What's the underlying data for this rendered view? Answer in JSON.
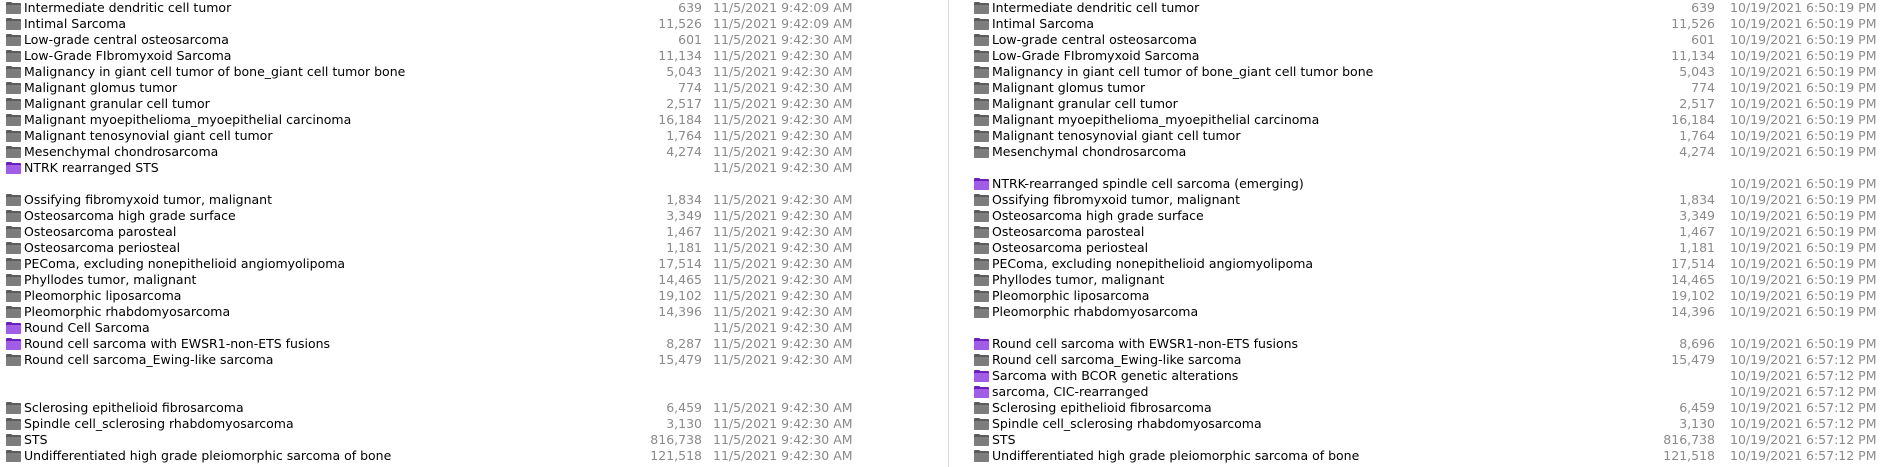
{
  "left_pane": {
    "rows": [
      {
        "name": "Intermediate dendritic cell tumor",
        "size": "639",
        "date": "11/5/2021 9:42:09 AM",
        "icon": "folder-gray-icon"
      },
      {
        "name": "Intimal Sarcoma",
        "size": "11,526",
        "date": "11/5/2021 9:42:09 AM",
        "icon": "folder-gray-icon"
      },
      {
        "name": "Low-grade central osteosarcoma",
        "size": "601",
        "date": "11/5/2021 9:42:30 AM",
        "icon": "folder-gray-icon"
      },
      {
        "name": "Low-Grade FIbromyxoid Sarcoma",
        "size": "11,134",
        "date": "11/5/2021 9:42:30 AM",
        "icon": "folder-gray-icon"
      },
      {
        "name": "Malignancy in giant cell tumor of bone_giant cell tumor bone",
        "size": "5,043",
        "date": "11/5/2021 9:42:30 AM",
        "icon": "folder-gray-icon"
      },
      {
        "name": "Malignant glomus tumor",
        "size": "774",
        "date": "11/5/2021 9:42:30 AM",
        "icon": "folder-gray-icon"
      },
      {
        "name": "Malignant granular cell tumor",
        "size": "2,517",
        "date": "11/5/2021 9:42:30 AM",
        "icon": "folder-gray-icon"
      },
      {
        "name": "Malignant myoepithelioma_myoepithelial carcinoma",
        "size": "16,184",
        "date": "11/5/2021 9:42:30 AM",
        "icon": "folder-gray-icon"
      },
      {
        "name": "Malignant tenosynovial giant cell tumor",
        "size": "1,764",
        "date": "11/5/2021 9:42:30 AM",
        "icon": "folder-gray-icon"
      },
      {
        "name": "Mesenchymal chondrosarcoma",
        "size": "4,274",
        "date": "11/5/2021 9:42:30 AM",
        "icon": "folder-gray-icon"
      },
      {
        "name": "NTRK rearranged STS",
        "size": "",
        "date": "11/5/2021 9:42:30 AM",
        "icon": "folder-purple-icon"
      },
      {
        "name": "",
        "size": "",
        "date": "",
        "icon": ""
      },
      {
        "name": "Ossifying fibromyxoid tumor, malignant",
        "size": "1,834",
        "date": "11/5/2021 9:42:30 AM",
        "icon": "folder-gray-icon"
      },
      {
        "name": "Osteosarcoma high grade surface",
        "size": "3,349",
        "date": "11/5/2021 9:42:30 AM",
        "icon": "folder-gray-icon"
      },
      {
        "name": "Osteosarcoma parosteal",
        "size": "1,467",
        "date": "11/5/2021 9:42:30 AM",
        "icon": "folder-gray-icon"
      },
      {
        "name": "Osteosarcoma periosteal",
        "size": "1,181",
        "date": "11/5/2021 9:42:30 AM",
        "icon": "folder-gray-icon"
      },
      {
        "name": "PEComa, excluding nonepithelioid angiomyolipoma",
        "size": "17,514",
        "date": "11/5/2021 9:42:30 AM",
        "icon": "folder-gray-icon"
      },
      {
        "name": "Phyllodes tumor, malignant",
        "size": "14,465",
        "date": "11/5/2021 9:42:30 AM",
        "icon": "folder-gray-icon"
      },
      {
        "name": "Pleomorphic liposarcoma",
        "size": "19,102",
        "date": "11/5/2021 9:42:30 AM",
        "icon": "folder-gray-icon"
      },
      {
        "name": "Pleomorphic rhabdomyosarcoma",
        "size": "14,396",
        "date": "11/5/2021 9:42:30 AM",
        "icon": "folder-gray-icon"
      },
      {
        "name": "Round Cell Sarcoma",
        "size": "",
        "date": "11/5/2021 9:42:30 AM",
        "icon": "folder-purple-icon"
      },
      {
        "name": "Round cell sarcoma with EWSR1-non-ETS fusions",
        "size": "8,287",
        "date": "11/5/2021 9:42:30 AM",
        "icon": "folder-purple-icon"
      },
      {
        "name": "Round cell sarcoma_Ewing-like sarcoma",
        "size": "15,479",
        "date": "11/5/2021 9:42:30 AM",
        "icon": "folder-gray-icon"
      },
      {
        "name": "",
        "size": "",
        "date": "",
        "icon": ""
      },
      {
        "name": "",
        "size": "",
        "date": "",
        "icon": ""
      },
      {
        "name": "Sclerosing epithelioid fibrosarcoma",
        "size": "6,459",
        "date": "11/5/2021 9:42:30 AM",
        "icon": "folder-gray-icon"
      },
      {
        "name": "Spindle cell_sclerosing rhabdomyosarcoma",
        "size": "3,130",
        "date": "11/5/2021 9:42:30 AM",
        "icon": "folder-gray-icon"
      },
      {
        "name": "STS",
        "size": "816,738",
        "date": "11/5/2021 9:42:30 AM",
        "icon": "folder-gray-icon"
      },
      {
        "name": "Undifferentiated high grade pleiomorphic sarcoma of bone",
        "size": "121,518",
        "date": "11/5/2021 9:42:30 AM",
        "icon": "folder-gray-icon"
      }
    ]
  },
  "right_pane": {
    "rows": [
      {
        "name": "Intermediate dendritic cell tumor",
        "size": "639",
        "date": "10/19/2021 6:50:19 PM",
        "icon": "folder-gray-icon"
      },
      {
        "name": "Intimal Sarcoma",
        "size": "11,526",
        "date": "10/19/2021 6:50:19 PM",
        "icon": "folder-gray-icon"
      },
      {
        "name": "Low-grade central osteosarcoma",
        "size": "601",
        "date": "10/19/2021 6:50:19 PM",
        "icon": "folder-gray-icon"
      },
      {
        "name": "Low-Grade FIbromyxoid Sarcoma",
        "size": "11,134",
        "date": "10/19/2021 6:50:19 PM",
        "icon": "folder-gray-icon"
      },
      {
        "name": "Malignancy in giant cell tumor of bone_giant cell tumor bone",
        "size": "5,043",
        "date": "10/19/2021 6:50:19 PM",
        "icon": "folder-gray-icon"
      },
      {
        "name": "Malignant glomus tumor",
        "size": "774",
        "date": "10/19/2021 6:50:19 PM",
        "icon": "folder-gray-icon"
      },
      {
        "name": "Malignant granular cell tumor",
        "size": "2,517",
        "date": "10/19/2021 6:50:19 PM",
        "icon": "folder-gray-icon"
      },
      {
        "name": "Malignant myoepithelioma_myoepithelial carcinoma",
        "size": "16,184",
        "date": "10/19/2021 6:50:19 PM",
        "icon": "folder-gray-icon"
      },
      {
        "name": "Malignant tenosynovial giant cell tumor",
        "size": "1,764",
        "date": "10/19/2021 6:50:19 PM",
        "icon": "folder-gray-icon"
      },
      {
        "name": "Mesenchymal chondrosarcoma",
        "size": "4,274",
        "date": "10/19/2021 6:50:19 PM",
        "icon": "folder-gray-icon"
      },
      {
        "name": "",
        "size": "",
        "date": "",
        "icon": ""
      },
      {
        "name": "NTRK-rearranged spindle cell sarcoma (emerging)",
        "size": "",
        "date": "10/19/2021 6:50:19 PM",
        "icon": "folder-purple-icon"
      },
      {
        "name": "Ossifying fibromyxoid tumor, malignant",
        "size": "1,834",
        "date": "10/19/2021 6:50:19 PM",
        "icon": "folder-gray-icon"
      },
      {
        "name": "Osteosarcoma high grade surface",
        "size": "3,349",
        "date": "10/19/2021 6:50:19 PM",
        "icon": "folder-gray-icon"
      },
      {
        "name": "Osteosarcoma parosteal",
        "size": "1,467",
        "date": "10/19/2021 6:50:19 PM",
        "icon": "folder-gray-icon"
      },
      {
        "name": "Osteosarcoma periosteal",
        "size": "1,181",
        "date": "10/19/2021 6:50:19 PM",
        "icon": "folder-gray-icon"
      },
      {
        "name": "PEComa, excluding nonepithelioid angiomyolipoma",
        "size": "17,514",
        "date": "10/19/2021 6:50:19 PM",
        "icon": "folder-gray-icon"
      },
      {
        "name": "Phyllodes tumor, malignant",
        "size": "14,465",
        "date": "10/19/2021 6:50:19 PM",
        "icon": "folder-gray-icon"
      },
      {
        "name": "Pleomorphic liposarcoma",
        "size": "19,102",
        "date": "10/19/2021 6:50:19 PM",
        "icon": "folder-gray-icon"
      },
      {
        "name": "Pleomorphic rhabdomyosarcoma",
        "size": "14,396",
        "date": "10/19/2021 6:50:19 PM",
        "icon": "folder-gray-icon"
      },
      {
        "name": "",
        "size": "",
        "date": "",
        "icon": ""
      },
      {
        "name": "Round cell sarcoma with EWSR1-non-ETS fusions",
        "size": "8,696",
        "date": "10/19/2021 6:50:19 PM",
        "icon": "folder-purple-icon"
      },
      {
        "name": "Round cell sarcoma_Ewing-like sarcoma",
        "size": "15,479",
        "date": "10/19/2021 6:57:12 PM",
        "icon": "folder-gray-icon"
      },
      {
        "name": "Sarcoma with BCOR genetic alterations",
        "size": "",
        "date": "10/19/2021 6:57:12 PM",
        "icon": "folder-purple-icon"
      },
      {
        "name": "sarcoma, CIC-rearranged",
        "size": "",
        "date": "10/19/2021 6:57:12 PM",
        "icon": "folder-purple-icon"
      },
      {
        "name": "Sclerosing epithelioid fibrosarcoma",
        "size": "6,459",
        "date": "10/19/2021 6:57:12 PM",
        "icon": "folder-gray-icon"
      },
      {
        "name": "Spindle cell_sclerosing rhabdomyosarcoma",
        "size": "3,130",
        "date": "10/19/2021 6:57:12 PM",
        "icon": "folder-gray-icon"
      },
      {
        "name": "STS",
        "size": "816,738",
        "date": "10/19/2021 6:57:12 PM",
        "icon": "folder-gray-icon"
      },
      {
        "name": "Undifferentiated high grade pleiomorphic sarcoma of bone",
        "size": "121,518",
        "date": "10/19/2021 6:57:12 PM",
        "icon": "folder-gray-icon"
      }
    ]
  },
  "colors": {
    "folder_gray": "#6b6b6b",
    "folder_purple": "#8a3fd6",
    "meta_text": "#8a8a8a"
  }
}
